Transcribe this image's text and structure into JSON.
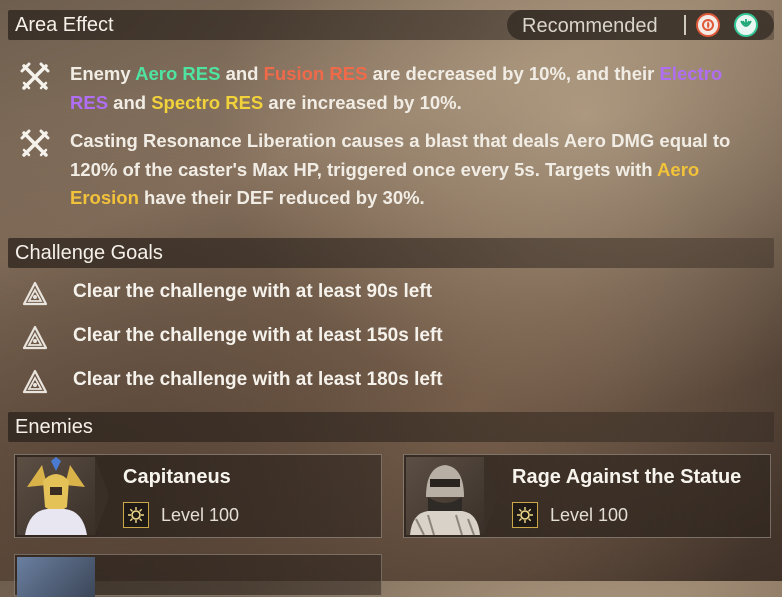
{
  "area_effect": {
    "title": "Area Effect",
    "recommended_label": "Recommended",
    "recommended_elements": [
      "fusion-icon",
      "aero-icon"
    ],
    "effects": [
      {
        "icon": "crossed-swords-icon",
        "parts": {
          "p1": "Enemy ",
          "aero_res": "Aero RES",
          "p2": " and ",
          "fusion_res": "Fusion RES",
          "p3": " are decreased by 10%, and their ",
          "electro_res": "Electro RES",
          "p4": " and ",
          "spectro_res": "Spectro RES",
          "p5": " are increased by 10%."
        }
      },
      {
        "icon": "crossed-swords-icon",
        "parts": {
          "p1": "Casting Resonance Liberation causes a blast that deals Aero DMG equal to 120% of the caster's Max HP, triggered once every 5s. Targets with ",
          "aero_erosion": "Aero Erosion",
          "p2": " have their DEF reduced by 30%."
        }
      }
    ]
  },
  "challenge_goals": {
    "title": "Challenge Goals",
    "goals": [
      "Clear the challenge with at least 90s left",
      "Clear the challenge with at least 150s left",
      "Clear the challenge with at least 180s left"
    ]
  },
  "enemies": {
    "title": "Enemies",
    "list": [
      {
        "name": "Capitaneus",
        "level": "Level 100"
      },
      {
        "name": "Rage Against the Statue",
        "level": "Level 100"
      }
    ]
  },
  "colors": {
    "aero": "#4fe3a2",
    "fusion": "#f06a4a",
    "electro": "#b06ef2",
    "spectro": "#f2d23a"
  }
}
